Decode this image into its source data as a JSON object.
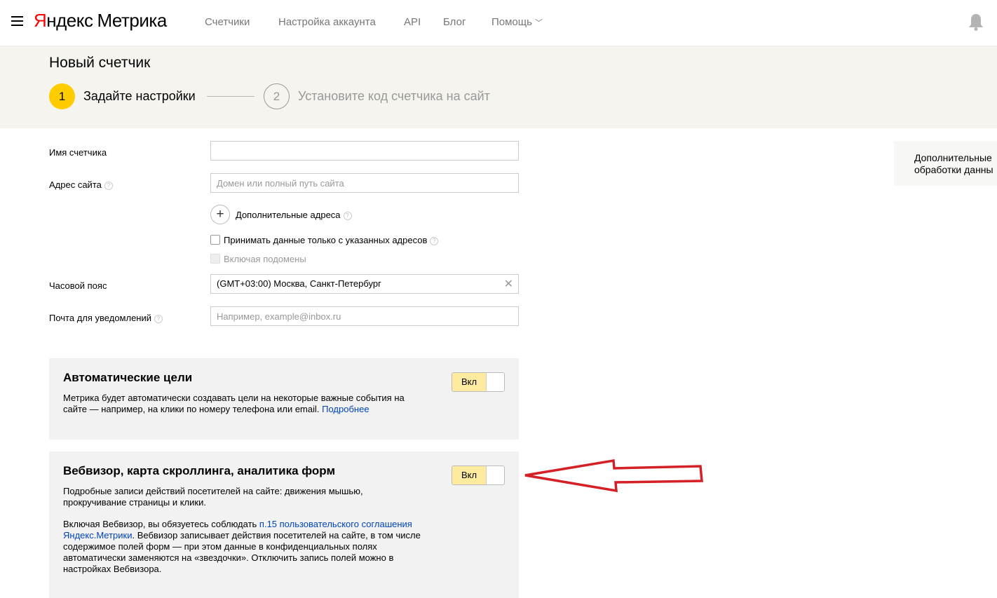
{
  "header": {
    "logo_yandex_y": "Я",
    "logo_yandex_rest": "ндекс",
    "logo_product": "Метрика",
    "nav": [
      "Счетчики",
      "Настройка аккаунта",
      "API",
      "Блог",
      "Помощь"
    ]
  },
  "page": {
    "title": "Новый счетчик",
    "steps": [
      {
        "number": "1",
        "label": "Задайте настройки"
      },
      {
        "number": "2",
        "label": "Установите код счетчика на сайт"
      }
    ]
  },
  "form": {
    "counter_name_label": "Имя счетчика",
    "counter_name_value": "",
    "site_address_label": "Адрес сайта",
    "site_address_placeholder": "Домен или полный путь сайта",
    "additional_addresses_label": "Дополнительные адреса",
    "only_specified_label": "Принимать данные только с указанных адресов",
    "include_subdomains_label": "Включая подомены",
    "timezone_label": "Часовой пояс",
    "timezone_value": "(GMT+03:00) Москва, Санкт-Петербург",
    "email_label": "Почта для уведомлений",
    "email_placeholder": "Например, example@inbox.ru"
  },
  "auto_goals": {
    "title": "Автоматические цели",
    "text": "Метрика будет автоматически создавать цели на некоторые важные события на сайте — например, на клики по номеру телефона или email.",
    "link": "Подробнее",
    "toggle_label": "Вкл"
  },
  "webvisor": {
    "title": "Вебвизор, карта скроллинга, аналитика форм",
    "text1": "Подробные записи действий посетителей на сайте: движения мышью, прокручивание страницы и клики.",
    "text2_prefix": "Включая Вебвизор, вы обязуетесь соблюдать ",
    "text2_link": "п.15 пользовательского соглашения Яндекс.Метрики",
    "text2_suffix": ". Вебвизор записывает действия посетителей на сайте, в том числе содержимое полей форм — при этом данные в конфиденциальных полях автоматически заменяются на «звездочки». Отключить запись полей можно в настройках Вебвизора.",
    "toggle_label": "Вкл"
  },
  "side": {
    "line1": "Дополнительные",
    "line2": "обработки данны"
  },
  "colors": {
    "accent": "#ffcc00",
    "toggle_on": "#ffeba0",
    "link": "#0044bb",
    "arrow": "#d42027",
    "header_band": "#f5f4ef"
  }
}
